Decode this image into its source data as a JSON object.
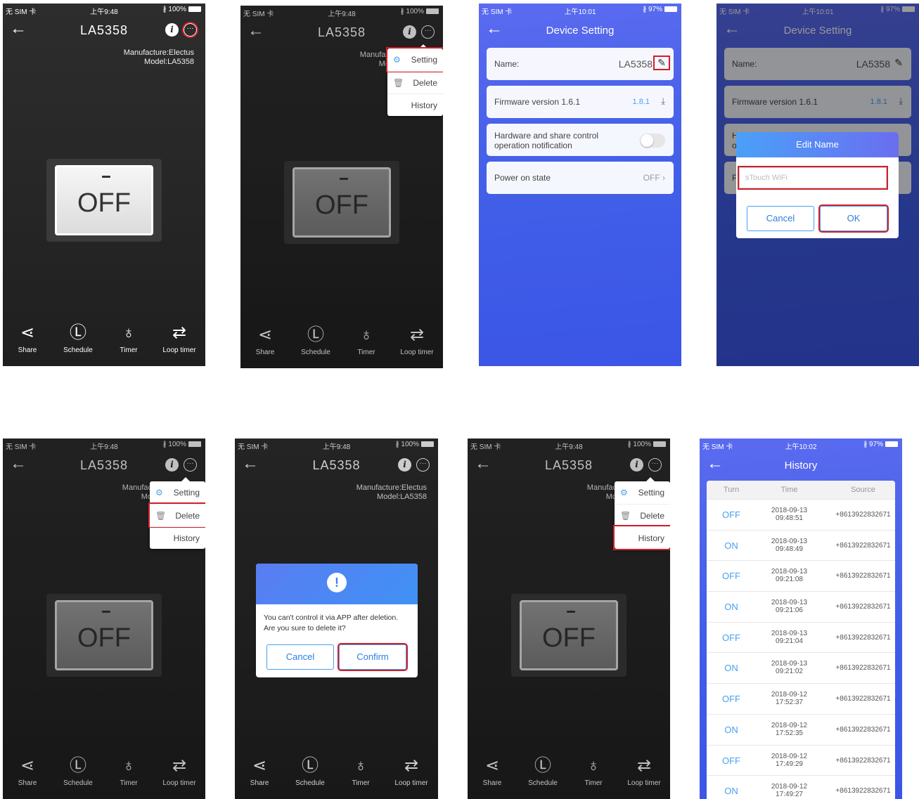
{
  "status": {
    "carrier": "无 SIM 卡",
    "wifi": "ᯤ",
    "time_948": "上午9:48",
    "time_1001": "上午10:01",
    "time_1002": "上午10:02",
    "batt_100": "∦ 100%",
    "batt_97": "∦ 97%"
  },
  "device": {
    "name": "LA5358",
    "manufacture": "Manufacture:Electus",
    "model": "Model:LA5358",
    "manufacture_cut": "Manufac",
    "model_cut": "Mo",
    "switch_state": "OFF"
  },
  "icons": {
    "back": "←",
    "info": "i",
    "more": "···",
    "gear": "⚙",
    "trash": "🗑",
    "pen": "✎",
    "download": "⤓",
    "chevron": "›",
    "alert": "!"
  },
  "menu": {
    "setting": "Setting",
    "delete": "Delete",
    "history": "History"
  },
  "toolbar": {
    "share": "Share",
    "schedule": "Schedule",
    "timer": "Timer",
    "loop_timer": "Loop timer"
  },
  "tool_icons": {
    "share": "⋖",
    "schedule": "Ⓛ",
    "timer": "♁",
    "loop_timer": "⇄"
  },
  "device_setting": {
    "title": "Device Setting",
    "name_label": "Name:",
    "name_value": "LA5358",
    "firmware_label": "Firmware version 1.6.1",
    "firmware_new": "1.8.1",
    "notify_line1": "Hardware and share control",
    "notify_line2": "operation notification",
    "notify_cut1": "H",
    "notify_cut2": "o",
    "power_label": "Power on state",
    "power_value": "OFF",
    "power_cut": "P"
  },
  "edit_dialog": {
    "title": "Edit Name",
    "placeholder": "sTouch WiFi",
    "cancel": "Cancel",
    "ok": "OK"
  },
  "delete_dialog": {
    "line1": "You can't control it via APP after deletion.",
    "line2": "Are you sure to delete it?",
    "cancel": "Cancel",
    "confirm": "Confirm"
  },
  "history": {
    "title": "History",
    "columns": [
      "Turn",
      "Time",
      "Source"
    ],
    "rows": [
      {
        "turn": "OFF",
        "date": "2018-09-13",
        "time": "09:48:51",
        "source": "+8613922832671"
      },
      {
        "turn": "ON",
        "date": "2018-09-13",
        "time": "09:48:49",
        "source": "+8613922832671"
      },
      {
        "turn": "OFF",
        "date": "2018-09-13",
        "time": "09:21:08",
        "source": "+8613922832671"
      },
      {
        "turn": "ON",
        "date": "2018-09-13",
        "time": "09:21:06",
        "source": "+8613922832671"
      },
      {
        "turn": "OFF",
        "date": "2018-09-13",
        "time": "09:21:04",
        "source": "+8613922832671"
      },
      {
        "turn": "ON",
        "date": "2018-09-13",
        "time": "09:21:02",
        "source": "+8613922832671"
      },
      {
        "turn": "OFF",
        "date": "2018-09-12",
        "time": "17:52:37",
        "source": "+8613922832671"
      },
      {
        "turn": "ON",
        "date": "2018-09-12",
        "time": "17:52:35",
        "source": "+8613922832671"
      },
      {
        "turn": "OFF",
        "date": "2018-09-12",
        "time": "17:49:29",
        "source": "+8613922832671"
      },
      {
        "turn": "ON",
        "date": "2018-09-12",
        "time": "17:49:27",
        "source": "+8613922832671"
      }
    ]
  },
  "colors": {
    "highlight": "#d21f2a",
    "accent": "#4aa0f0",
    "dark_bg": "#262626",
    "blue_bg": "#3f5de8"
  }
}
